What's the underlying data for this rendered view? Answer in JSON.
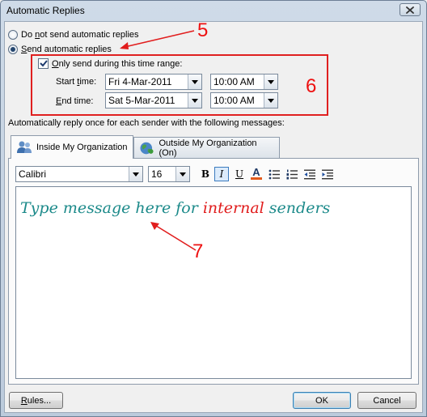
{
  "window": {
    "title": "Automatic Replies"
  },
  "options": {
    "do_not_send_pre": "Do ",
    "do_not_send_key": "n",
    "do_not_send_post": "ot send automatic replies",
    "send_key": "S",
    "send_post": "end automatic replies",
    "selected": "send"
  },
  "time_range": {
    "checked": true,
    "label_key": "O",
    "label_post": "nly send during this time range:",
    "start_label_pre": "Start ",
    "start_label_key": "t",
    "start_label_post": "ime:",
    "start_date": "Fri 4-Mar-2011",
    "start_time": "10:00 AM",
    "end_label_pre": "",
    "end_label_key": "E",
    "end_label_post": "nd time:",
    "end_date": "Sat 5-Mar-2011",
    "end_time": "10:00 AM"
  },
  "reply_section": {
    "caption": "Automatically reply once for each sender with the following messages:"
  },
  "tabs": [
    {
      "label": "Inside My Organization",
      "active": true,
      "icon": "people-icon"
    },
    {
      "label": "Outside My Organization (On)",
      "active": false,
      "icon": "globe-icon"
    }
  ],
  "format_toolbar": {
    "font_name": "Calibri",
    "font_size": "16",
    "bold": "B",
    "italic": "I",
    "underline": "U",
    "font_color": "A",
    "font_color_swatch": "#e25a1c",
    "italic_active": true
  },
  "editor": {
    "text_part1": "Type message here for ",
    "text_part2": "internal",
    "text_part3": " senders",
    "color_main": "#1c8a8a",
    "color_highlight": "#e11d1d"
  },
  "annotations": {
    "label_5": "5",
    "label_6": "6",
    "label_7": "7",
    "color": "#e11d1d"
  },
  "buttons": {
    "rules_key": "R",
    "rules_post": "ules...",
    "ok": "OK",
    "cancel": "Cancel"
  }
}
